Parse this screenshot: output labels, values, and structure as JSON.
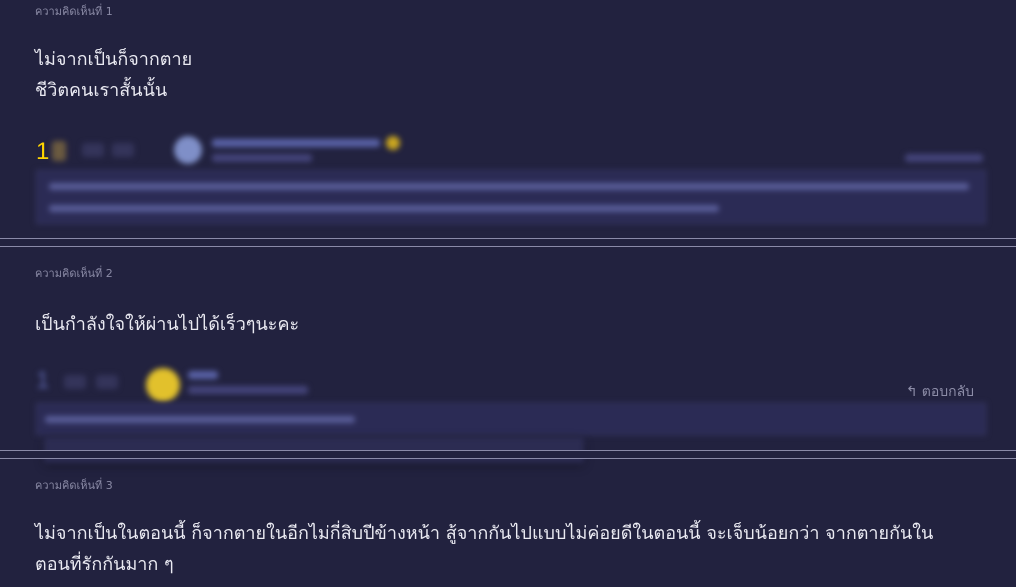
{
  "comments": [
    {
      "label": "ความคิดเห็นที่ 1",
      "lines": [
        "ไม่จากเป็นก็จากตาย",
        "ชีวิตคนเราสั้นนั้น"
      ],
      "vote_count": "1"
    },
    {
      "label": "ความคิดเห็นที่ 2",
      "lines": [
        "เป็นกำลังใจให้ผ่านไปได้เร็วๆนะคะ"
      ],
      "vote_count": "1",
      "reply_label": "ตอบกลับ"
    },
    {
      "label": "ความคิดเห็นที่ 3",
      "lines": [
        "ไม่จากเป็นในตอนนี้ ก็จากตายในอีกไม่กี่สิบปีข้างหน้า สู้จากกันไปแบบไม่ค่อยดีในตอนนี้ จะเจ็บน้อยกว่า จากตายกันใน",
        "ตอนที่รักกันมาก ๆ"
      ]
    }
  ],
  "icons": {
    "reply": "reply-arrow-icon",
    "vote_up": "plus-icon",
    "vote_down": "minus-icon"
  },
  "colors": {
    "background": "#22223f",
    "vote_count": "#ffd400",
    "muted_text": "#8b8ba6",
    "divider": "#8a8aa8"
  }
}
